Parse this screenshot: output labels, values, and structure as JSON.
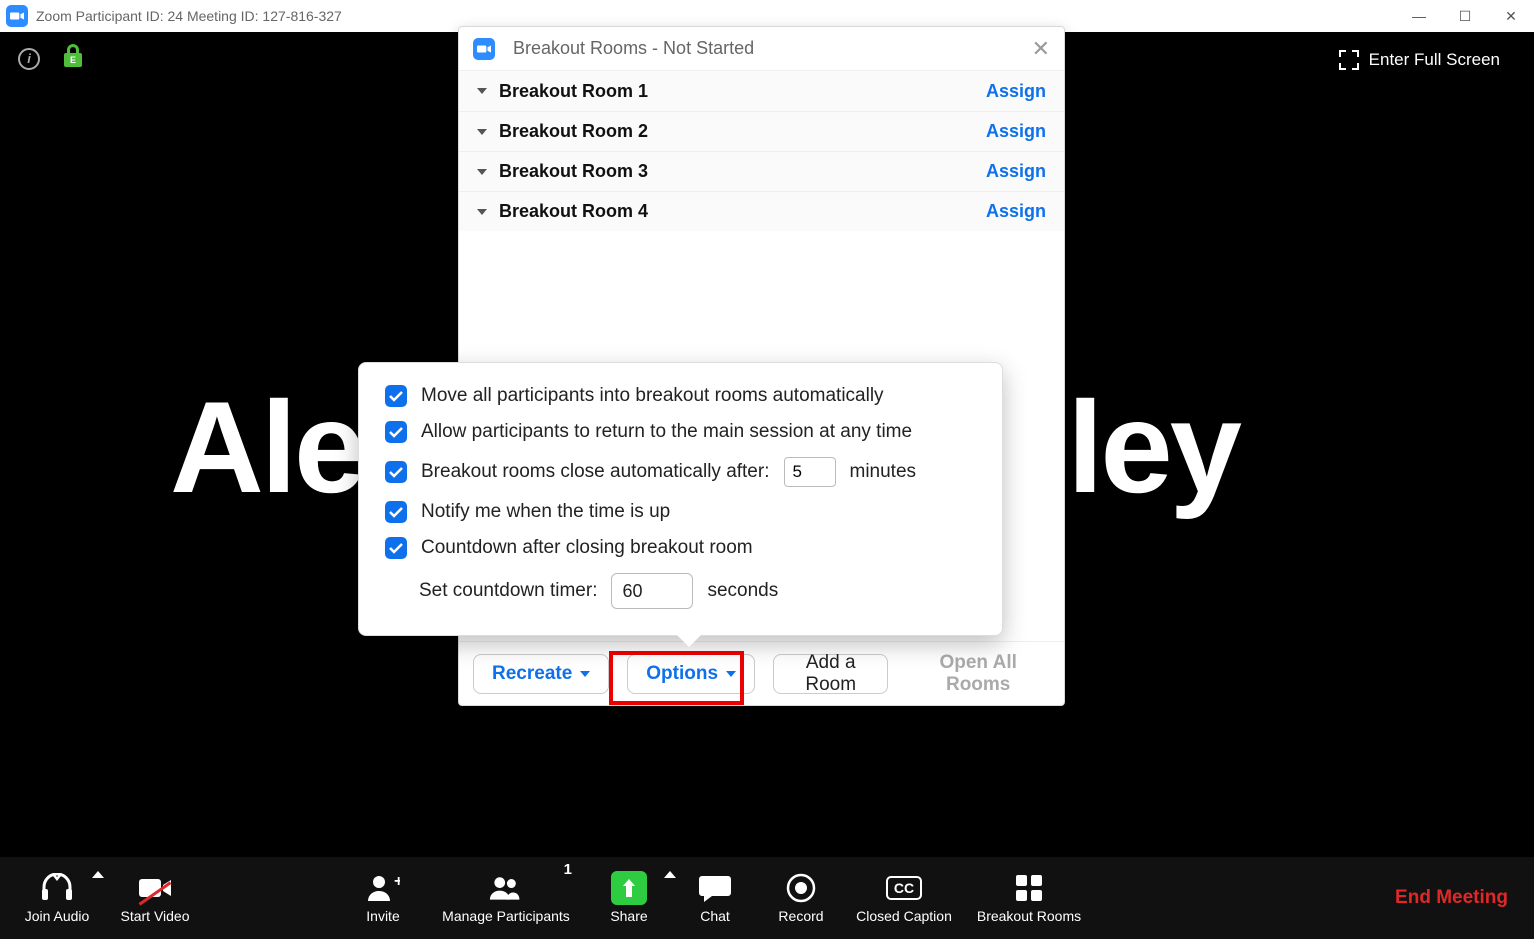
{
  "titlebar": {
    "text": "Zoom Participant ID: 24   Meeting ID: 127-816-327"
  },
  "video": {
    "name_left": "Ale",
    "name_right": "ley",
    "fullscreen_label": "Enter Full Screen"
  },
  "breakout": {
    "title": "Breakout Rooms - Not Started",
    "rooms": [
      {
        "name": "Breakout Room 1",
        "action": "Assign"
      },
      {
        "name": "Breakout Room 2",
        "action": "Assign"
      },
      {
        "name": "Breakout Room 3",
        "action": "Assign"
      },
      {
        "name": "Breakout Room 4",
        "action": "Assign"
      }
    ],
    "footer": {
      "recreate": "Recreate",
      "options": "Options",
      "add_room": "Add a Room",
      "open_all": "Open All Rooms"
    }
  },
  "options": {
    "move_auto": "Move all participants into breakout rooms automatically",
    "allow_return": "Allow participants to return to the main session at any time",
    "close_after_label": "Breakout rooms close automatically after:",
    "close_after_value": "5",
    "close_after_unit": "minutes",
    "notify": "Notify me when the time is up",
    "countdown": "Countdown after closing breakout room",
    "countdown_label": "Set countdown timer:",
    "countdown_value": "60",
    "countdown_unit": "seconds"
  },
  "toolbar": {
    "join_audio": "Join Audio",
    "start_video": "Start Video",
    "invite": "Invite",
    "manage": "Manage Participants",
    "manage_count": "1",
    "share": "Share",
    "chat": "Chat",
    "record": "Record",
    "cc": "Closed Caption",
    "cc_icon": "CC",
    "breakout": "Breakout Rooms",
    "end": "End Meeting"
  }
}
